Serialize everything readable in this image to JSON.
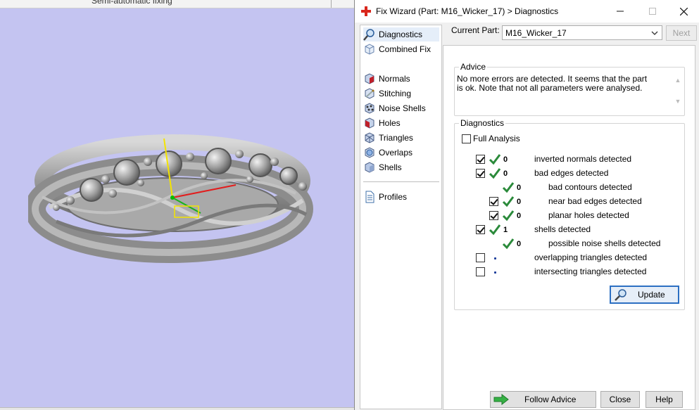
{
  "viewport": {
    "toolbar_label": "Semi-automatic fixing"
  },
  "window": {
    "title": "Fix Wizard (Part: M16_Wicker_17) > Diagnostics",
    "minimize_glyph": "—",
    "maximize_glyph": "☐",
    "close_glyph": "✕"
  },
  "nav": {
    "items": [
      {
        "label": "Diagnostics",
        "icon": "magnifier-icon"
      },
      {
        "label": "Combined Fix",
        "icon": "cube-icon"
      },
      {
        "label": "Normals",
        "icon": "normals-cube-icon"
      },
      {
        "label": "Stitching",
        "icon": "stitching-icon"
      },
      {
        "label": "Noise Shells",
        "icon": "noise-shells-icon"
      },
      {
        "label": "Holes",
        "icon": "holes-icon"
      },
      {
        "label": "Triangles",
        "icon": "triangles-icon"
      },
      {
        "label": "Overlaps",
        "icon": "overlaps-icon"
      },
      {
        "label": "Shells",
        "icon": "shells-icon"
      },
      {
        "label": "Profiles",
        "icon": "document-icon"
      }
    ]
  },
  "part": {
    "label": "Current Part:",
    "value": "M16_Wicker_17",
    "next_label": "Next"
  },
  "advice": {
    "group_label": "Advice",
    "text": "No more errors are detected. It seems that the part is ok. Note that not all parameters were analysed."
  },
  "diagnostics": {
    "group_label": "Diagnostics",
    "full_analysis_label": "Full Analysis",
    "rows": [
      {
        "checked": true,
        "status": "ok",
        "count": "0",
        "label": "inverted normals detected"
      },
      {
        "checked": true,
        "status": "ok",
        "count": "0",
        "label": "bad edges detected"
      },
      {
        "checked": null,
        "status": "ok",
        "count": "0",
        "label": "bad contours detected"
      },
      {
        "checked": true,
        "status": "ok",
        "count": "0",
        "label": "near bad edges detected"
      },
      {
        "checked": true,
        "status": "ok",
        "count": "0",
        "label": "planar holes detected"
      },
      {
        "checked": true,
        "status": "ok",
        "count": "1",
        "label": "shells detected"
      },
      {
        "checked": null,
        "status": "ok",
        "count": "0",
        "label": "possible noise shells detected"
      },
      {
        "checked": false,
        "status": "none",
        "count": "",
        "label": "overlapping triangles detected"
      },
      {
        "checked": false,
        "status": "none",
        "count": "",
        "label": "intersecting triangles detected"
      }
    ],
    "update_label": "Update"
  },
  "buttons": {
    "follow_advice": "Follow Advice",
    "close": "Close",
    "help": "Help"
  },
  "colors": {
    "viewport_bg": "#c4c4f1",
    "check_green": "#2a8a3a",
    "accent_blue": "#2c6fc2",
    "logo_red": "#d9261c"
  }
}
